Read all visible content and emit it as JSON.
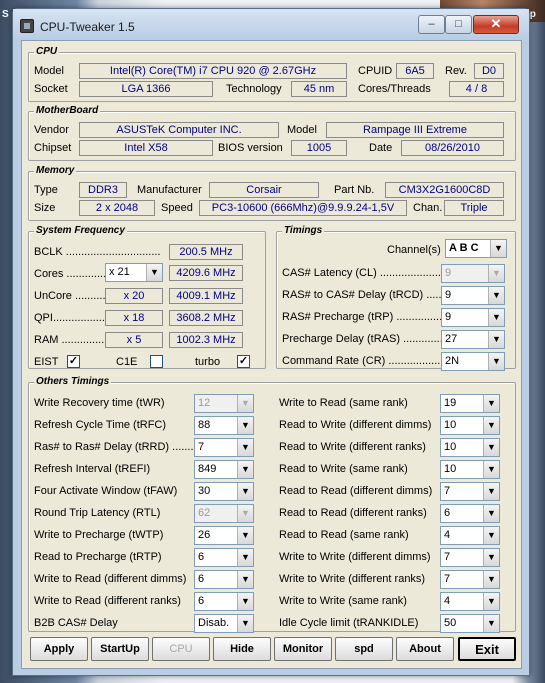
{
  "window": {
    "title": "CPU-Tweaker 1.5",
    "min": "–",
    "max": "□",
    "close": "✕"
  },
  "background": {
    "corner_text": "S",
    "topright_text": "Rep"
  },
  "cpu": {
    "legend": "CPU",
    "model_lbl": "Model",
    "model": "Intel(R) Core(TM) i7 CPU        920  @ 2.67GHz",
    "cpuid_lbl": "CPUID",
    "cpuid": "6A5",
    "rev_lbl": "Rev.",
    "rev": "D0",
    "socket_lbl": "Socket",
    "socket": "LGA 1366",
    "tech_lbl": "Technology",
    "tech": "45 nm",
    "ct_lbl": "Cores/Threads",
    "ct": "4 / 8"
  },
  "mb": {
    "legend": "MotherBoard",
    "vendor_lbl": "Vendor",
    "vendor": "ASUSTeK Computer INC.",
    "model_lbl": "Model",
    "model": "Rampage III Extreme",
    "chipset_lbl": "Chipset",
    "chipset": "Intel X58",
    "bios_lbl": "BIOS version",
    "bios": "1005",
    "date_lbl": "Date",
    "date": "08/26/2010"
  },
  "mem": {
    "legend": "Memory",
    "type_lbl": "Type",
    "type": "DDR3",
    "manu_lbl": "Manufacturer",
    "manu": "Corsair",
    "part_lbl": "Part Nb.",
    "part": "CM3X2G1600C8D",
    "size_lbl": "Size",
    "size": "2 x 2048",
    "speed_lbl": "Speed",
    "speed": "PC3-10600 (666Mhz)@9.9.9.24-1,5V",
    "chan_lbl": "Chan.",
    "chan": "Triple"
  },
  "sysfreq": {
    "legend": "System Frequency",
    "bclk_lbl": "BCLK ...............................",
    "bclk": "200.5 MHz",
    "cores_lbl": "Cores ...................",
    "cores_mult": "x 21",
    "cores": "4209.6 MHz",
    "uncore_lbl": "UnCore ..................",
    "uncore_mult": "x 20",
    "uncore": "4009.1 MHz",
    "qpi_lbl": "QPI....................",
    "qpi_mult": "x 18",
    "qpi": "3608.2 MHz",
    "ram_lbl": "RAM .....................",
    "ram_mult": "x 5",
    "ram": "1002.3 MHz",
    "eist_lbl": "EIST",
    "c1e_lbl": "C1E",
    "turbo_lbl": "turbo",
    "check": "✓"
  },
  "timings": {
    "legend": "Timings",
    "channels_lbl": "Channel(s)",
    "channels": "A B C",
    "rows": [
      {
        "label": "CAS# Latency (CL) ............................",
        "value": "9"
      },
      {
        "label": "RAS# to CAS# Delay (tRCD) ..........",
        "value": "9"
      },
      {
        "label": "RAS# Precharge (tRP) ....................",
        "value": "9"
      },
      {
        "label": "Precharge Delay (tRAS) ..................",
        "value": "27"
      },
      {
        "label": "Command Rate (CR) .......................",
        "value": "2N"
      }
    ]
  },
  "others": {
    "legend": "Others Timings",
    "left": [
      {
        "label": "Write Recovery time (tWR)",
        "value": "12"
      },
      {
        "label": "Refresh Cycle Time (tRFC)",
        "value": "88"
      },
      {
        "label": "Ras# to Ras# Delay (tRRD) ..........",
        "value": "7"
      },
      {
        "label": "Refresh Interval (tREFI)",
        "value": "849"
      },
      {
        "label": "Four Activate Window (tFAW)",
        "value": "30"
      },
      {
        "label": "Round Trip Latency (RTL)",
        "value": "62"
      },
      {
        "label": "Write to Precharge (tWTP)",
        "value": "26"
      },
      {
        "label": "Read to Precharge (tRTP)",
        "value": "6"
      },
      {
        "label": "Write to Read (different dimms)",
        "value": "6"
      },
      {
        "label": "Write to Read (different ranks)",
        "value": "6"
      },
      {
        "label": "B2B CAS# Delay",
        "value": "Disab."
      }
    ],
    "right": [
      {
        "label": "Write to Read (same rank)",
        "value": "19"
      },
      {
        "label": "Read to Write (different dimms)",
        "value": "10"
      },
      {
        "label": "Read to Write (different ranks)",
        "value": "10"
      },
      {
        "label": "Read to Write (same rank)",
        "value": "10"
      },
      {
        "label": "Read to Read (different dimms)",
        "value": "7"
      },
      {
        "label": "Read to Read (different ranks)",
        "value": "6"
      },
      {
        "label": "Read to Read (same rank)",
        "value": "4"
      },
      {
        "label": "Write to Write (different dimms)",
        "value": "7"
      },
      {
        "label": "Write to Write (different ranks)",
        "value": "7"
      },
      {
        "label": "Write to Write (same rank)",
        "value": "4"
      },
      {
        "label": "Idle Cycle limit (tRANKIDLE)",
        "value": "50"
      }
    ]
  },
  "buttons": {
    "apply": "Apply",
    "startup": "StartUp",
    "cpu": "CPU",
    "hide": "Hide",
    "monitor": "Monitor",
    "spd": "spd",
    "about": "About",
    "exit": "Exit"
  }
}
